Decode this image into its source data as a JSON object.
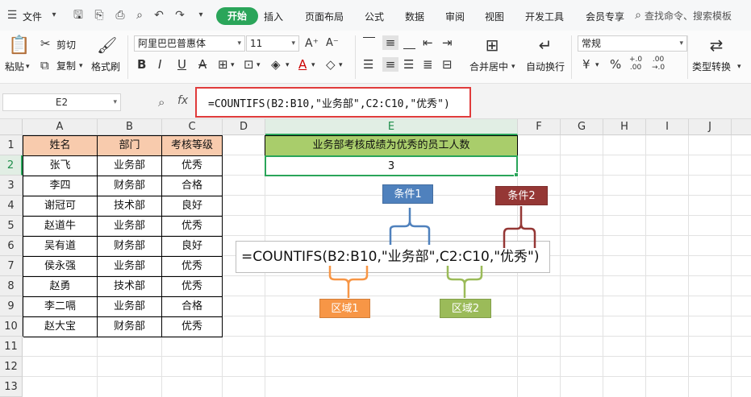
{
  "app": {
    "file_menu": "文件",
    "tabs": [
      "开始",
      "插入",
      "页面布局",
      "公式",
      "数据",
      "审阅",
      "视图",
      "开发工具",
      "会员专享"
    ],
    "active_tab": "开始",
    "search_placeholder": "查找命令、搜索模板"
  },
  "ribbon": {
    "paste": "粘贴",
    "cut": "剪切",
    "copy": "复制",
    "format_painter": "格式刷",
    "font_name": "阿里巴巴普惠体",
    "font_size": "11",
    "merge_center": "合并居中",
    "wrap_text": "自动换行",
    "number_format": "常规",
    "type_convert": "类型转换",
    "bold": "B",
    "italic": "I",
    "underline": "U",
    "percent": "%",
    "dec_increase": "+.0\n.00",
    "dec_decrease": ".00\n→.0",
    "currency": "¥"
  },
  "formula_bar": {
    "name_box": "E2",
    "fx": "fx",
    "formula": "=COUNTIFS(B2:B10,\"业务部\",C2:C10,\"优秀\")"
  },
  "sheet": {
    "columns": [
      "A",
      "B",
      "C",
      "D",
      "E",
      "F",
      "G",
      "H",
      "I",
      "J"
    ],
    "rows": [
      "1",
      "2",
      "3",
      "4",
      "5",
      "6",
      "7",
      "8",
      "9",
      "10",
      "11",
      "12",
      "13"
    ],
    "table_header": [
      "姓名",
      "部门",
      "考核等级"
    ],
    "table_rows": [
      [
        "张飞",
        "业务部",
        "优秀"
      ],
      [
        "李四",
        "财务部",
        "合格"
      ],
      [
        "谢冠可",
        "技术部",
        "良好"
      ],
      [
        "赵道牛",
        "业务部",
        "优秀"
      ],
      [
        "吴有道",
        "财务部",
        "良好"
      ],
      [
        "侯永强",
        "业务部",
        "优秀"
      ],
      [
        "赵勇",
        "技术部",
        "优秀"
      ],
      [
        "李二嗝",
        "业务部",
        "合格"
      ],
      [
        "赵大宝",
        "财务部",
        "优秀"
      ]
    ],
    "result_title": "业务部考核成绩为优秀的员工人数",
    "result_value": "3"
  },
  "annotation": {
    "formula": "=COUNTIFS(B2:B10,\"业务部\",C2:C10,\"优秀\")",
    "condition1": "条件1",
    "condition2": "条件2",
    "range1": "区域1",
    "range2": "区域2",
    "colors": {
      "condition1": "#4f81bd",
      "condition2": "#953735",
      "range1": "#f79646",
      "range2": "#9bbb59"
    }
  }
}
